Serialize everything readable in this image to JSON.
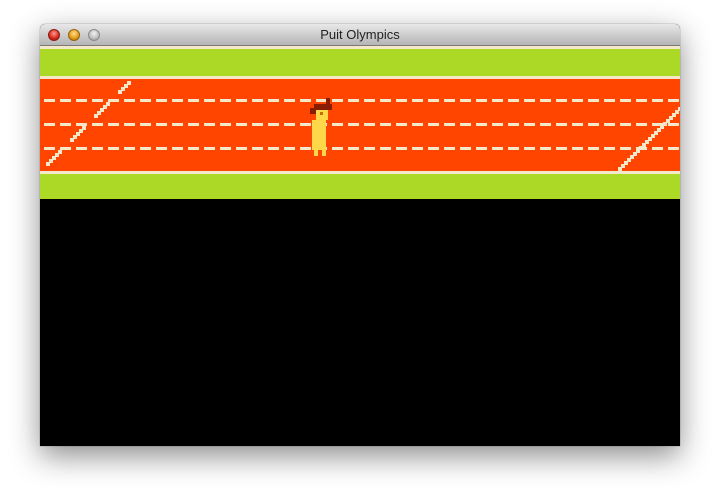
{
  "window": {
    "title": "Puit Olympics"
  },
  "icons": {
    "close": "close-button-icon",
    "minimize": "minimize-button-icon",
    "zoom": "zoom-button-icon"
  },
  "colors": {
    "grass": "#acd926",
    "track": "#ff4500",
    "line": "#f5e8c8",
    "background": "#000000",
    "runner_body": "#ffd84a",
    "runner_hair": "#8a1c00"
  }
}
